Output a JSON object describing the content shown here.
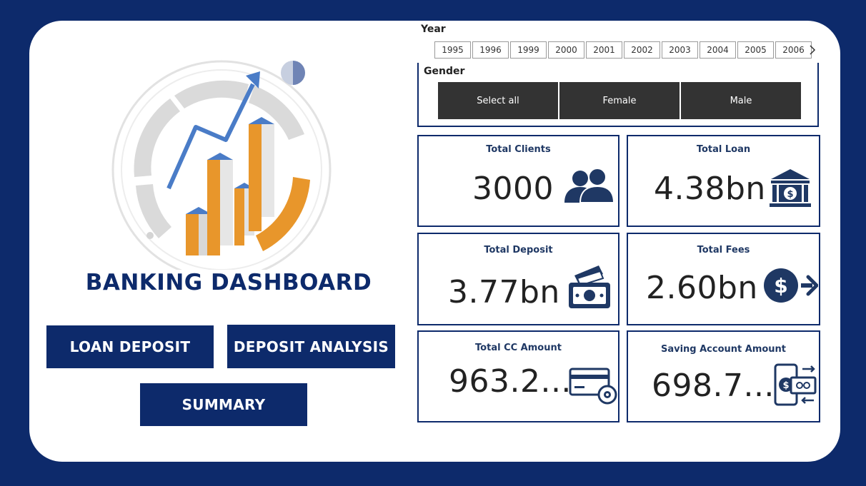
{
  "brand": {
    "title": "BANKING DASHBOARD"
  },
  "nav": {
    "loan_deposit": "LOAN DEPOSIT",
    "deposit_analysis": "DEPOSIT ANALYSIS",
    "summary": "SUMMARY"
  },
  "year_slicer": {
    "label": "Year",
    "years": [
      "1995",
      "1996",
      "1999",
      "2000",
      "2001",
      "2002",
      "2003",
      "2004",
      "2005",
      "2006"
    ]
  },
  "gender_slicer": {
    "label": "Gender",
    "options": [
      "Select all",
      "Female",
      "Male"
    ]
  },
  "kpis": {
    "total_clients": {
      "title": "Total Clients",
      "value": "3000"
    },
    "total_loan": {
      "title": "Total Loan",
      "value": "4.38bn"
    },
    "total_deposit": {
      "title": "Total Deposit",
      "value": "3.77bn"
    },
    "total_fees": {
      "title": "Total Fees",
      "value": "2.60bn"
    },
    "total_cc_amount": {
      "title": "Total CC Amount",
      "value": "963.2..."
    },
    "saving_account_amount": {
      "title": "Saving Account Amount",
      "value": "698.7..."
    }
  },
  "colors": {
    "navy": "#0d2a6b",
    "orange": "#e8962b",
    "blue": "#4a7cc7",
    "slicer_dark": "#333333"
  }
}
